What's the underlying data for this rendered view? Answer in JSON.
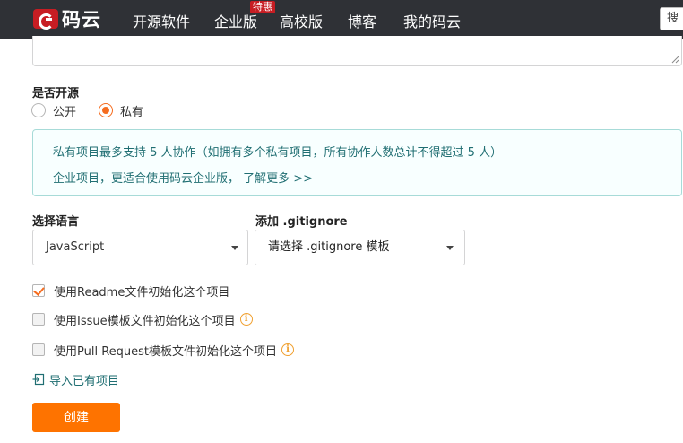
{
  "nav": {
    "logo_text": "码云",
    "items": [
      {
        "label": "开源软件"
      },
      {
        "label": "企业版"
      },
      {
        "label": "高校版"
      },
      {
        "label": "博客"
      },
      {
        "label": "我的码云"
      }
    ],
    "badge": "特惠",
    "search_label": "搜"
  },
  "form": {
    "open_source_label": "是否开源",
    "visibility_options": [
      {
        "label": "公开",
        "checked": false
      },
      {
        "label": "私有",
        "checked": true
      }
    ],
    "info": {
      "line1": "私有项目最多支持 5 人协作（如拥有多个私有项目，所有协作人数总计不得超过 5 人）",
      "line2_text": "企业项目，更适合使用码云企业版，",
      "line2_link": "了解更多 >>"
    },
    "language_label": "选择语言",
    "language_value": "JavaScript",
    "gitignore_label": "添加 .gitignore",
    "gitignore_value": "请选择 .gitignore 模板",
    "checkboxes": [
      {
        "label": "使用Readme文件初始化这个项目",
        "checked": true,
        "info": false
      },
      {
        "label": "使用Issue模板文件初始化这个项目",
        "checked": false,
        "info": true
      },
      {
        "label": "使用Pull Request模板文件初始化这个项目",
        "checked": false,
        "info": true
      }
    ],
    "import_label": "导入已有项目",
    "create_label": "创建"
  },
  "colors": {
    "nav_bg": "#2f3136",
    "brand_red": "#c71d23",
    "accent_orange": "#fe7300",
    "info_text": "#1f6e72",
    "info_border": "#a7dbd8"
  }
}
